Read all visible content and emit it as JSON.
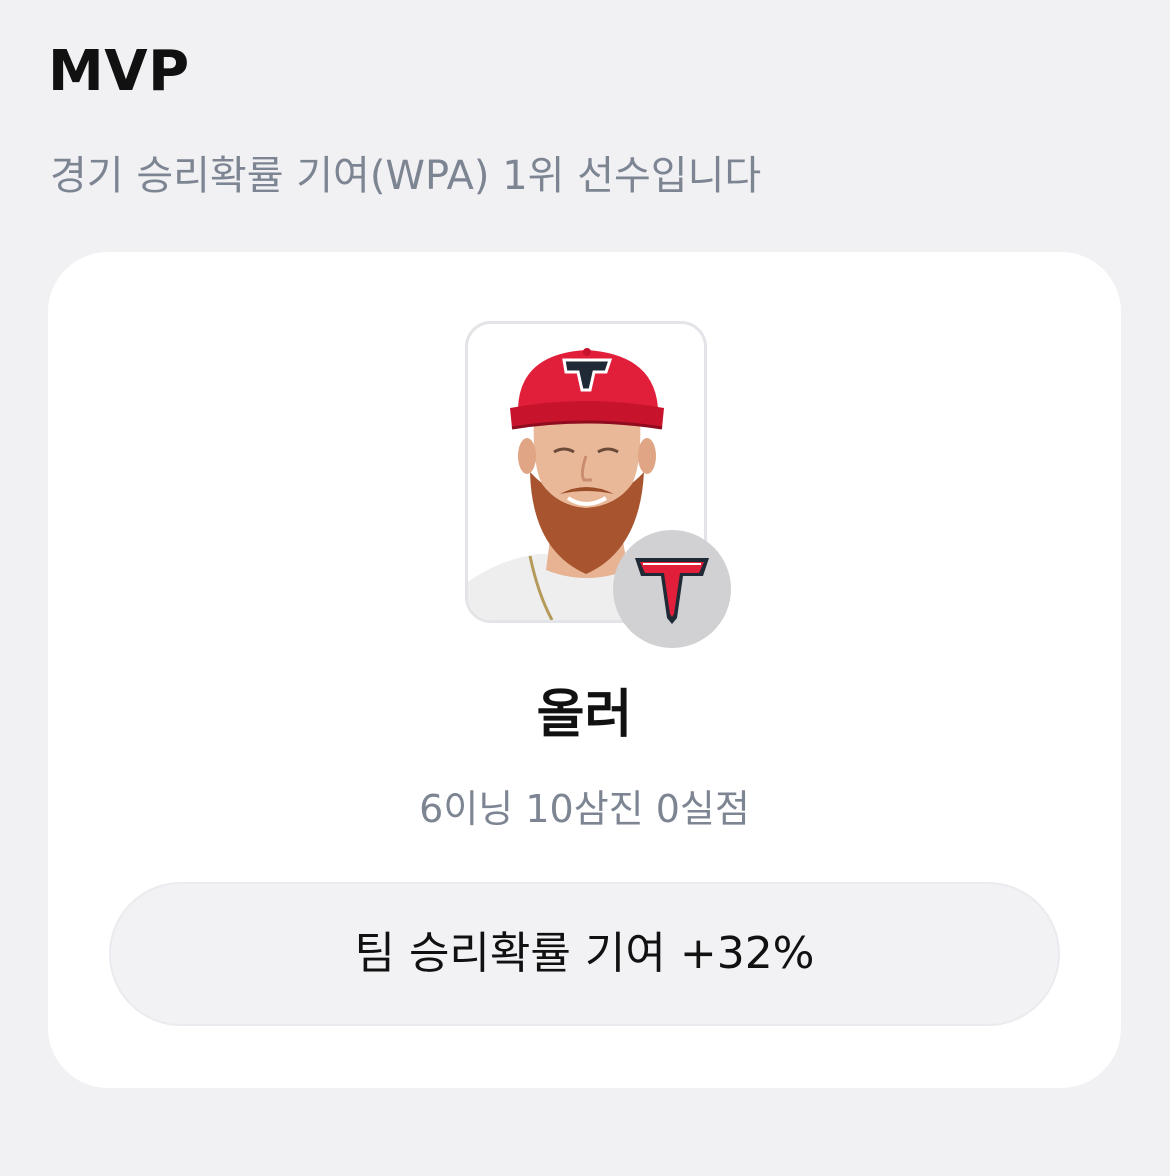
{
  "header": {
    "title": "MVP",
    "subtitle": "경기 승리확률 기여(WPA) 1위 선수입니다"
  },
  "player": {
    "name": "올러",
    "stats": "6이닝 10삼진 0실점",
    "photo_icon": "player-portrait",
    "team_logo_icon": "team-t-logo"
  },
  "wpa": {
    "label": "팀 승리확률 기여",
    "value": "+32%"
  },
  "colors": {
    "background": "#f1f1f4",
    "card": "#ffffff",
    "subtitle_text": "#7d8593",
    "pill_background": "#f2f2f5",
    "team_red": "#e21f3a",
    "badge_background": "#d1d1d3"
  }
}
